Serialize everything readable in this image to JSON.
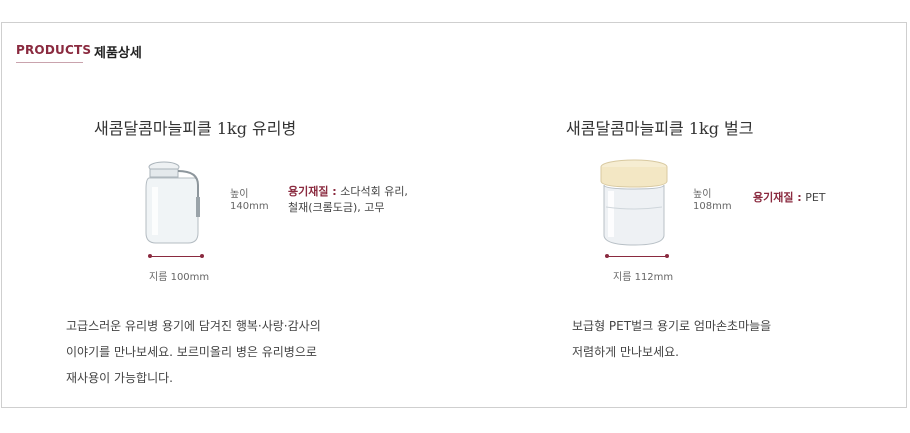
{
  "section": {
    "label_en": "PRODUCTS",
    "label_ko": "제품상세"
  },
  "products": [
    {
      "title": "새콤달콤마늘피클 1kg 유리병",
      "height_label": "높이",
      "height_value": "140mm",
      "material_label": "용기재질 :",
      "material_line1": "소다석회 유리,",
      "material_line2": "철재(크롬도금), 고무",
      "diameter_text": "지름 100mm",
      "desc_lines": [
        "고급스러운 유리병 용기에 담겨진 행복·사랑·감사의",
        "이야기를 만나보세요. 보르미올리 병은 유리병으로",
        "재사용이 가능합니다."
      ]
    },
    {
      "title": "새콤달콤마늘피클 1kg 벌크",
      "height_label": "높이",
      "height_value": "108mm",
      "material_label": "용기재질 :",
      "material_line1": "PET",
      "diameter_text": "지름 112mm",
      "desc_lines": [
        "보급형 PET벌크 용기로 엄마손초마늘을",
        "저렴하게 만나보세요."
      ]
    }
  ],
  "colors": {
    "accent": "#8a2a3f",
    "border": "#cfcfcf",
    "lid_cream": "#f3e7c4"
  },
  "icons": [
    "glass-jar-image",
    "pet-jar-image"
  ]
}
